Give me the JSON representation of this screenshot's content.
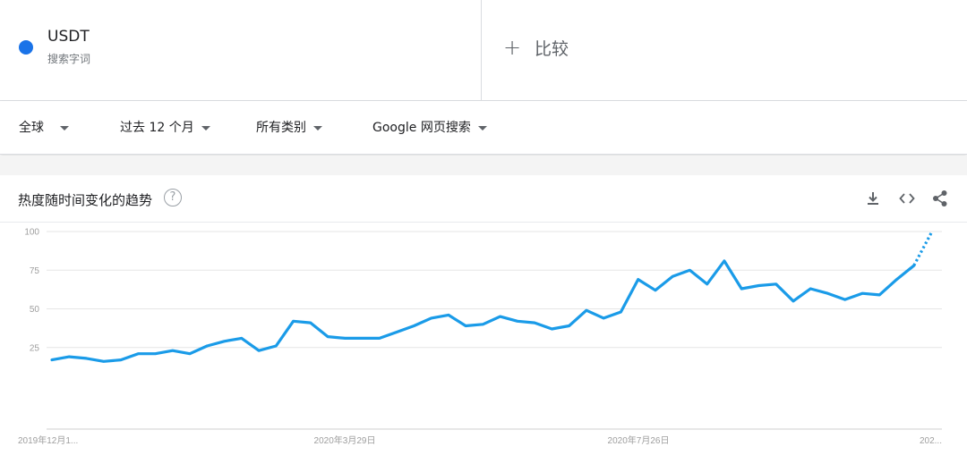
{
  "term": {
    "name": "USDT",
    "type": "搜索字词",
    "color": "#1a73e8"
  },
  "compare": {
    "icon": "plus-icon",
    "label": "比较"
  },
  "filters": {
    "region": "全球",
    "time": "过去 12 个月",
    "category": "所有类别",
    "property": "Google 网页搜索"
  },
  "card": {
    "title": "热度随时间变化的趋势",
    "help_glyph": "?",
    "tools": [
      "download-icon",
      "embed-icon",
      "share-icon"
    ]
  },
  "chart_data": {
    "type": "line",
    "title": "热度随时间变化的趋势",
    "xlabel": "",
    "ylabel": "",
    "ylim": [
      0,
      100
    ],
    "y_ticks": [
      25,
      50,
      75,
      100
    ],
    "x_tick_labels": [
      "2019年12月1...",
      "2020年3月29日",
      "2020年7月26日",
      "202..."
    ],
    "grid": true,
    "line_color": "#1a9be8",
    "series": [
      {
        "name": "USDT",
        "values": [
          17,
          19,
          18,
          16,
          17,
          21,
          21,
          23,
          21,
          26,
          29,
          31,
          23,
          26,
          42,
          41,
          32,
          31,
          31,
          31,
          35,
          39,
          44,
          46,
          39,
          40,
          45,
          42,
          41,
          37,
          39,
          49,
          44,
          48,
          69,
          62,
          71,
          75,
          66,
          81,
          63,
          65,
          66,
          55,
          63,
          60,
          56,
          60,
          59,
          69,
          78
        ],
        "partial_values": [
          78,
          99
        ]
      }
    ]
  }
}
